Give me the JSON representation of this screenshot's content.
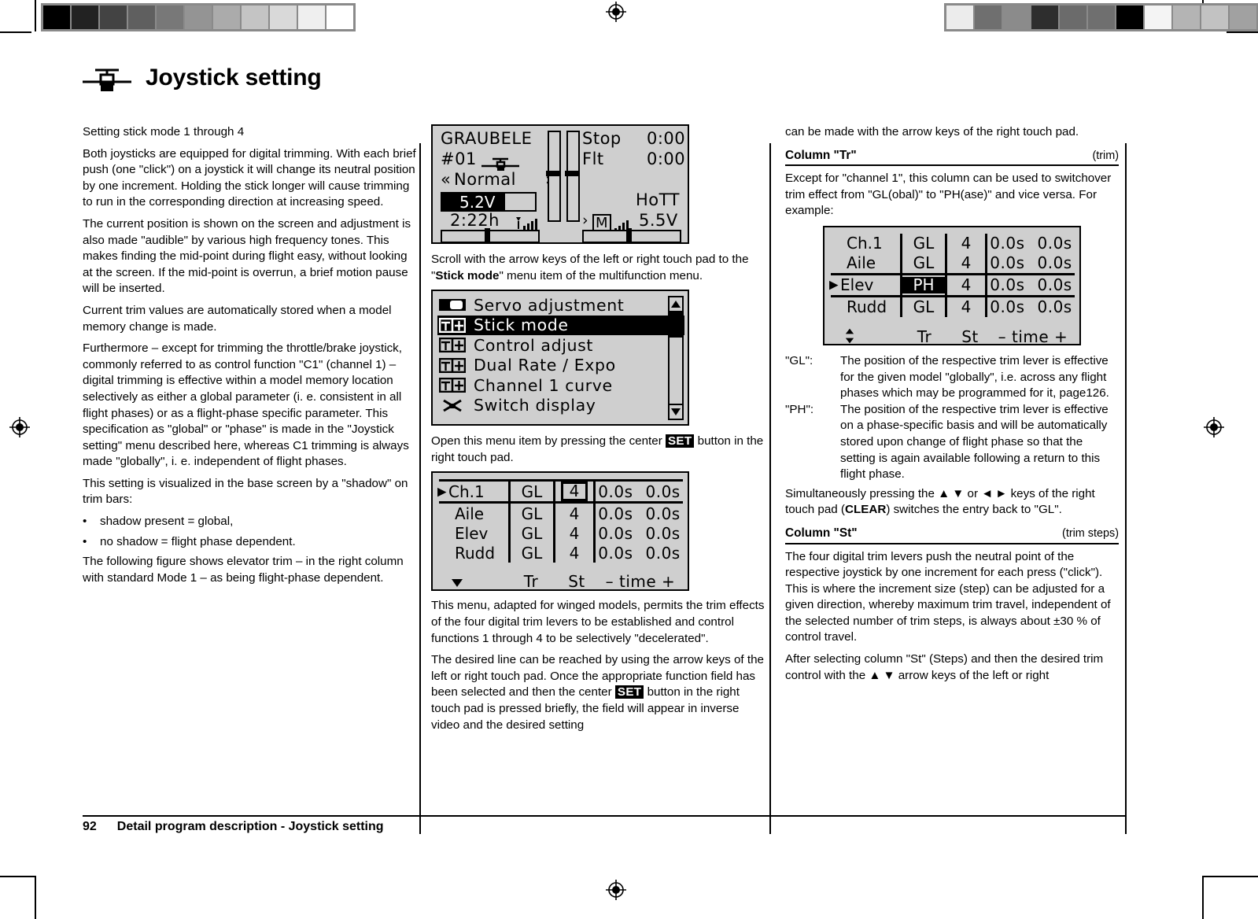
{
  "print_marks": {
    "left_swatches": [
      "#000000",
      "#222222",
      "#434343",
      "#5f5f5f",
      "#787878",
      "#949494",
      "#ababab",
      "#c4c4c4",
      "#d9d9d9",
      "#efefef",
      "#ffffff"
    ],
    "right_swatches": [
      "#ececec",
      "#6f6f6f",
      "#8b8b8b",
      "#2e2e2e",
      "#6b6b6b",
      "#6f6f6f",
      "#000000",
      "#f4f4f4",
      "#b4b4b4",
      "#c2c2c2",
      "#a1a1a1"
    ],
    "registration_icon": "registration-target-icon"
  },
  "header": {
    "icon": "trim-lever-icon",
    "title": "Joystick setting",
    "subtitle": "Setting stick mode 1 through 4"
  },
  "col1": {
    "p1": "Both joysticks are equipped for digital trimming. With each brief push (one \"click\") on a joystick it will change its neutral position by one increment. Holding the stick longer will cause trimming to run in the corresponding direction at increasing speed.",
    "p2": "The current position is shown on the screen and adjustment is also made \"audible\" by various high frequency tones. This makes finding the mid-point during flight easy, without looking at the screen. If the mid-point is overrun, a brief motion pause will be inserted.",
    "p3": "Current trim values are automatically stored when a model memory change is made.",
    "p4": "Furthermore – except for trimming the throttle/brake joystick, commonly referred to as control function \"C1\" (channel 1) –  digital trimming is effective within a model memory location selectively as either a global parameter (i. e. consistent in all flight phases) or as a flight-phase specific parameter. This specification as \"global\" or \"phase\" is made in the \"Joystick setting\" menu described here, whereas C1 trimming is always made \"globally\", i. e. independent of flight phases.",
    "p5": "This setting is visualized in the base screen by a \"shadow\" on trim bars:",
    "bullets": [
      "shadow present = global,",
      "no shadow = flight phase dependent."
    ],
    "p6": "The following figure shows elevator trim – in the right column with standard Mode 1 –  as being flight-phase dependent."
  },
  "base_screen": {
    "model_name": "GRAUBELE",
    "memory": "#01",
    "model_icon": "glider-model-icon",
    "phase_left_arrows": "«",
    "phase": "Normal",
    "phase_right_arrows": "»",
    "voltage": "5.2V",
    "voltage_fill_pct": 68,
    "timer": "2:22h",
    "tx_signal_icon": "antenna-signal-icon",
    "stop_label": "Stop",
    "stop_value": "0:00",
    "flt_label": "Flt",
    "flt_value": "0:00",
    "protocol": "HoTT",
    "rx_marker": "›",
    "rx_icon": "M",
    "rx_signal_icon": "rx-signal-icon",
    "rx_voltage": "5.5V"
  },
  "col2": {
    "p_scroll_a": "Scroll with the arrow keys of the left or right touch pad to the \"",
    "p_scroll_b": "Stick mode",
    "p_scroll_c": "\" menu item of the multifunction menu.",
    "p_open_a": "Open this menu item by pressing the center ",
    "p_open_set": "SET",
    "p_open_b": " button in the right touch pad.",
    "p_menu": "This menu, adapted for winged models, permits the trim effects of the four digital trim levers to be established and control functions 1 through 4 to be selectively \"decelerated\".",
    "p_line_a": "The desired line can be reached by using the arrow keys of the left or right touch pad. Once the appropriate function field has been selected and then the center ",
    "p_line_set": "SET",
    "p_line_b": " button in the right touch pad is pressed briefly, the field will appear in inverse video and the desired setting"
  },
  "menu_screen": {
    "items": [
      {
        "icon": "servo-icon",
        "label": "Servo adjustment",
        "selected": false
      },
      {
        "icon": "stick-icon",
        "label": "Stick mode",
        "selected": true
      },
      {
        "icon": "control-icon",
        "label": "Control adjust",
        "selected": false
      },
      {
        "icon": "dualrate-icon",
        "label": "Dual Rate / Expo",
        "selected": false
      },
      {
        "icon": "curve-icon",
        "label": "Channel 1 curve",
        "selected": false
      },
      {
        "icon": "switch-icon",
        "label": "Switch display",
        "selected": false
      }
    ],
    "scroll_up_icon": "triangle-up-icon",
    "scroll_down_icon": "triangle-down-icon"
  },
  "trim_screen_mid": {
    "rows": [
      {
        "name": "Ch.1",
        "tr": "GL",
        "st": "4",
        "t1": "0.0s",
        "t2": "0.0s",
        "cursor": true,
        "st_selected": true,
        "tr_highlight": false
      },
      {
        "name": "Aile",
        "tr": "GL",
        "st": "4",
        "t1": "0.0s",
        "t2": "0.0s",
        "cursor": false,
        "st_selected": false,
        "tr_highlight": false
      },
      {
        "name": "Elev",
        "tr": "GL",
        "st": "4",
        "t1": "0.0s",
        "t2": "0.0s",
        "cursor": false,
        "st_selected": false,
        "tr_highlight": false
      },
      {
        "name": "Rudd",
        "tr": "GL",
        "st": "4",
        "t1": "0.0s",
        "t2": "0.0s",
        "cursor": false,
        "st_selected": false,
        "tr_highlight": false
      }
    ],
    "foot_nav_icon": "triangle-down-icon",
    "foot_tr": "Tr",
    "foot_st": "St",
    "foot_time": "–  time  +"
  },
  "trim_screen_right": {
    "rows": [
      {
        "name": "Ch.1",
        "tr": "GL",
        "st": "4",
        "t1": "0.0s",
        "t2": "0.0s",
        "cursor": false,
        "st_selected": false,
        "tr_highlight": false
      },
      {
        "name": "Aile",
        "tr": "GL",
        "st": "4",
        "t1": "0.0s",
        "t2": "0.0s",
        "cursor": false,
        "st_selected": false,
        "tr_highlight": false
      },
      {
        "name": "Elev",
        "tr": "PH",
        "st": "4",
        "t1": "0.0s",
        "t2": "0.0s",
        "cursor": true,
        "st_selected": false,
        "tr_highlight": true
      },
      {
        "name": "Rudd",
        "tr": "GL",
        "st": "4",
        "t1": "0.0s",
        "t2": "0.0s",
        "cursor": false,
        "st_selected": false,
        "tr_highlight": false
      }
    ],
    "foot_nav_icon": "up-down-arrow-icon",
    "foot_tr": "Tr",
    "foot_st": "St",
    "foot_time": "–  time  +"
  },
  "col3": {
    "p_top": "can be made with the arrow keys of the right touch pad.",
    "sect_tr_title": "Column \"Tr\"",
    "sect_tr_note": "(trim)",
    "p_tr": "Except for \"channel 1\", this column can be used to switchover trim effect from \"GL(obal)\" to \"PH(ase)\" and vice versa. For example:",
    "def_gl_term": "\"GL\":",
    "def_gl_text": "The position of the respective trim lever is effective for the given model \"globally\", i.e. across any flight phases which may be programmed for it, page126.",
    "def_ph_term": "\"PH\":",
    "def_ph_text": "The position of the respective trim lever is effective on a phase-specific basis and will be automatically stored upon change of flight phase so that the setting is again available following a return to this flight phase.",
    "p_clear_a": "Simultaneously pressing the ",
    "p_clear_ud": "▲ ▼",
    "p_clear_b": " or ",
    "p_clear_lr": "◄ ►",
    "p_clear_c": " keys of the right touch pad (",
    "p_clear_bold": "CLEAR",
    "p_clear_d": ") switches the entry back to \"GL\".",
    "sect_st_title": "Column \"St\"",
    "sect_st_note": "(trim steps)",
    "p_st1": "The four digital trim levers push the neutral point of the respective joystick by one increment for each press (\"click\"). This is where the increment size (step) can be adjusted for a given direction, whereby maximum trim travel, independent of the selected number of trim steps, is always about ±30 % of control travel.",
    "p_st2_a": "After selecting column \"St\" (Steps) and then the desired trim control with the ",
    "p_st2_ud": "▲ ▼",
    "p_st2_b": " arrow keys of the left or right"
  },
  "footer": {
    "page": "92",
    "text": "Detail program description - Joystick setting"
  }
}
